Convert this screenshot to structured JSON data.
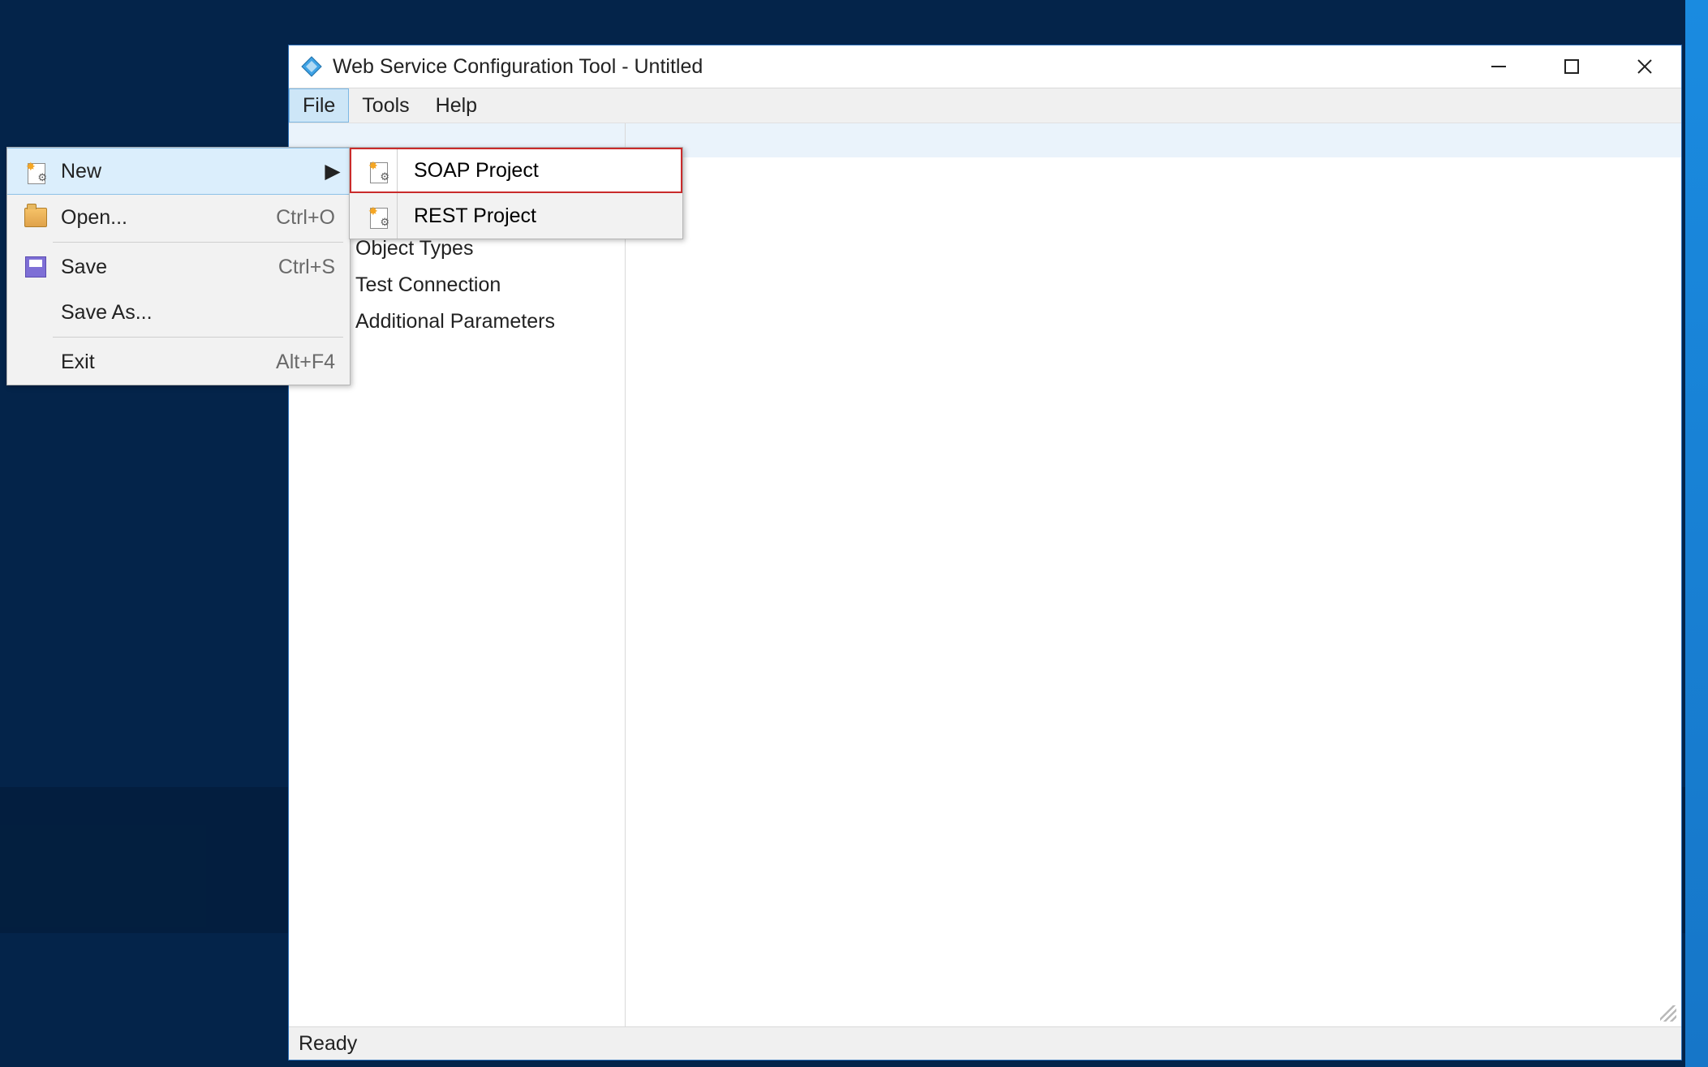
{
  "window": {
    "title": "Web Service Configuration Tool - Untitled"
  },
  "menubar": {
    "file": "File",
    "tools": "Tools",
    "help": "Help"
  },
  "file_menu": {
    "new": "New",
    "open": "Open...",
    "open_shortcut": "Ctrl+O",
    "save": "Save",
    "save_shortcut": "Ctrl+S",
    "save_as": "Save As...",
    "exit": "Exit",
    "exit_shortcut": "Alt+F4"
  },
  "new_submenu": {
    "soap": "SOAP Project",
    "rest": "REST Project"
  },
  "tree": {
    "object_types": "Object Types",
    "test_connection": "Test Connection",
    "additional_parameters": "Additional Parameters"
  },
  "statusbar": {
    "text": "Ready"
  }
}
